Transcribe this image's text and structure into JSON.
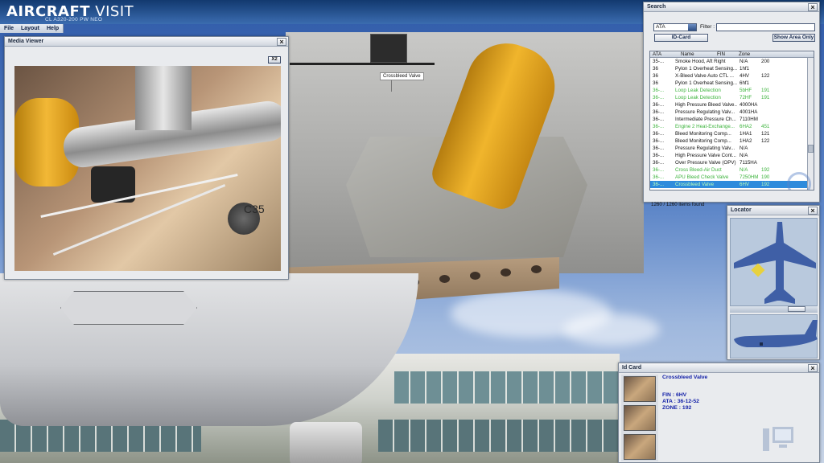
{
  "app": {
    "logo_text_bold": "AIRCRAFT",
    "logo_text_light": " VISIT",
    "subtitle": "CL A320-200 PW NEO"
  },
  "menu": [
    "File",
    "Layout",
    "Help"
  ],
  "scene": {
    "tooltip": "Crossbleed Valve",
    "photo_label": "C35"
  },
  "media_viewer": {
    "title": "Media Viewer",
    "zoom_button": "X2"
  },
  "search": {
    "title": "Search",
    "ata_select": "ATA",
    "filter_label": "Filter :",
    "filter_value": "",
    "id_card_button": "ID-Card",
    "show_area_button": "Show Area Only",
    "columns": [
      "ATA",
      "Name",
      "FIN",
      "Zone"
    ],
    "rows": [
      {
        "ata": "35-...",
        "name": "Smoke Hood, Aft Right",
        "fin": "N/A",
        "zone": "200",
        "style": ""
      },
      {
        "ata": "36",
        "name": "Pylon 1 Overheat Sensing...",
        "fin": "1hf1",
        "zone": "",
        "style": ""
      },
      {
        "ata": "36",
        "name": "X-Bleed Valve Auto CTL ...",
        "fin": "4HV",
        "zone": "122",
        "style": ""
      },
      {
        "ata": "36",
        "name": "Pylon 1 Overheat Sensing...",
        "fin": "6hf1",
        "zone": "",
        "style": ""
      },
      {
        "ata": "36-...",
        "name": "Loop Leak Detection",
        "fin": "5bHF",
        "zone": "191",
        "style": "green"
      },
      {
        "ata": "36-...",
        "name": "Loop Leak Detection",
        "fin": "72HF",
        "zone": "191",
        "style": "green"
      },
      {
        "ata": "36-...",
        "name": "High Pressure Bleed Valve...",
        "fin": "4000HA",
        "zone": "",
        "style": ""
      },
      {
        "ata": "36-...",
        "name": "Pressure Regulating Valv...",
        "fin": "4001HA",
        "zone": "",
        "style": ""
      },
      {
        "ata": "36-...",
        "name": "Intermediate Pressure Ch...",
        "fin": "7110HM",
        "zone": "",
        "style": ""
      },
      {
        "ata": "36-...",
        "name": "Engine 2 Heat-Exchange...",
        "fin": "6HA2",
        "zone": "451",
        "style": "green"
      },
      {
        "ata": "36-...",
        "name": "Bleed Monitoring Comp...",
        "fin": "1HA1",
        "zone": "121",
        "style": ""
      },
      {
        "ata": "36-...",
        "name": "Bleed Monitoring Comp...",
        "fin": "1HA2",
        "zone": "122",
        "style": ""
      },
      {
        "ata": "36-...",
        "name": "Pressure Regulating Valv...",
        "fin": "N/A",
        "zone": "",
        "style": ""
      },
      {
        "ata": "36-...",
        "name": "High Pressure Valve Cont...",
        "fin": "N/A",
        "zone": "",
        "style": ""
      },
      {
        "ata": "36-...",
        "name": "Over Pressure Valve (OPV)",
        "fin": "7115HA",
        "zone": "",
        "style": ""
      },
      {
        "ata": "36-...",
        "name": "Cross Bleed-Air Duct",
        "fin": "N/A",
        "zone": "192",
        "style": "green"
      },
      {
        "ata": "36-...",
        "name": "APU Bleed Check Valve",
        "fin": "7250HM",
        "zone": "190",
        "style": "green"
      },
      {
        "ata": "36-...",
        "name": "Crossbleed Valve",
        "fin": "6HV",
        "zone": "192",
        "style": "sel"
      }
    ],
    "count": "1260 / 1260 items found"
  },
  "locator": {
    "title": "Locator"
  },
  "id_card": {
    "title": "Id Card",
    "name": "Crossbleed Valve",
    "fin": "FIN : 6HV",
    "ata": "ATA : 36-12-52",
    "zone": "ZONE : 192"
  },
  "colors": {
    "title_bar": "#12396f",
    "green_row": "#3bb33b",
    "selected_row": "#2e8bdc",
    "id_card_text": "#1421a8"
  }
}
